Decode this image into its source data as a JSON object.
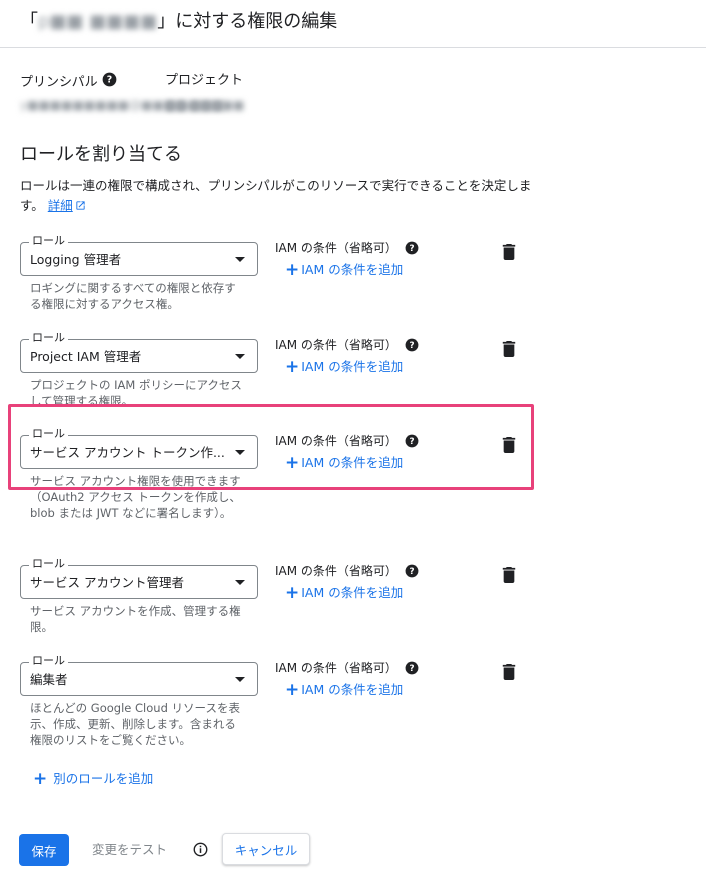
{
  "header": {
    "title_prefix": "「",
    "project_name_redacted": "p■■ ■■■■",
    "title_suffix": "」に対する権限の編集"
  },
  "principal": {
    "label": "プリンシパル",
    "value_redacted": "y■■■■■■■■■@■■■■.■■■"
  },
  "project": {
    "label": "プロジェクト",
    "value_redacted": "■■■■■■■"
  },
  "assign_roles": {
    "title": "ロールを割り当てる",
    "description": "ロールは一連の権限で構成され、プリンシパルがこのリソースで実行できることを決定します。",
    "learn_more": "詳細"
  },
  "roles": [
    {
      "field_label": "ロール",
      "value": "Logging 管理者",
      "description": "ロギングに関するすべての権限と依存する権限に対するアクセス権。",
      "condition_label": "IAM の条件（省略可）",
      "add_condition": "IAM の条件を追加"
    },
    {
      "field_label": "ロール",
      "value": "Project IAM 管理者",
      "description": "プロジェクトの IAM ポリシーにアクセスして管理する権限。",
      "condition_label": "IAM の条件（省略可）",
      "add_condition": "IAM の条件を追加"
    },
    {
      "field_label": "ロール",
      "value": "サービス アカウント トークン作...",
      "description": "サービス アカウント権限を使用できます（OAuth2 アクセス トークンを作成し、blob または JWT などに署名します）。",
      "condition_label": "IAM の条件（省略可）",
      "add_condition": "IAM の条件を追加"
    },
    {
      "field_label": "ロール",
      "value": "サービス アカウント管理者",
      "description": "サービス アカウントを作成、管理する権限。",
      "condition_label": "IAM の条件（省略可）",
      "add_condition": "IAM の条件を追加"
    },
    {
      "field_label": "ロール",
      "value": "編集者",
      "description": "ほとんどの Google Cloud リソースを表示、作成、更新、削除します。含まれる権限のリストをご覧ください。",
      "condition_label": "IAM の条件（省略可）",
      "add_condition": "IAM の条件を追加"
    }
  ],
  "add_role": "別のロールを追加",
  "footer": {
    "save": "保存",
    "test_changes": "変更をテスト",
    "cancel": "キャンセル"
  },
  "icons": {
    "help": "help-circle-icon",
    "delete": "trash-icon",
    "external_link": "open-in-new-icon",
    "info": "info-icon",
    "dropdown": "arrow-drop-down-icon",
    "plus": "plus-icon"
  },
  "colors": {
    "accent": "#1a73e8",
    "highlight": "#e8417a",
    "text": "#202124",
    "secondary_text": "#5f6368"
  }
}
